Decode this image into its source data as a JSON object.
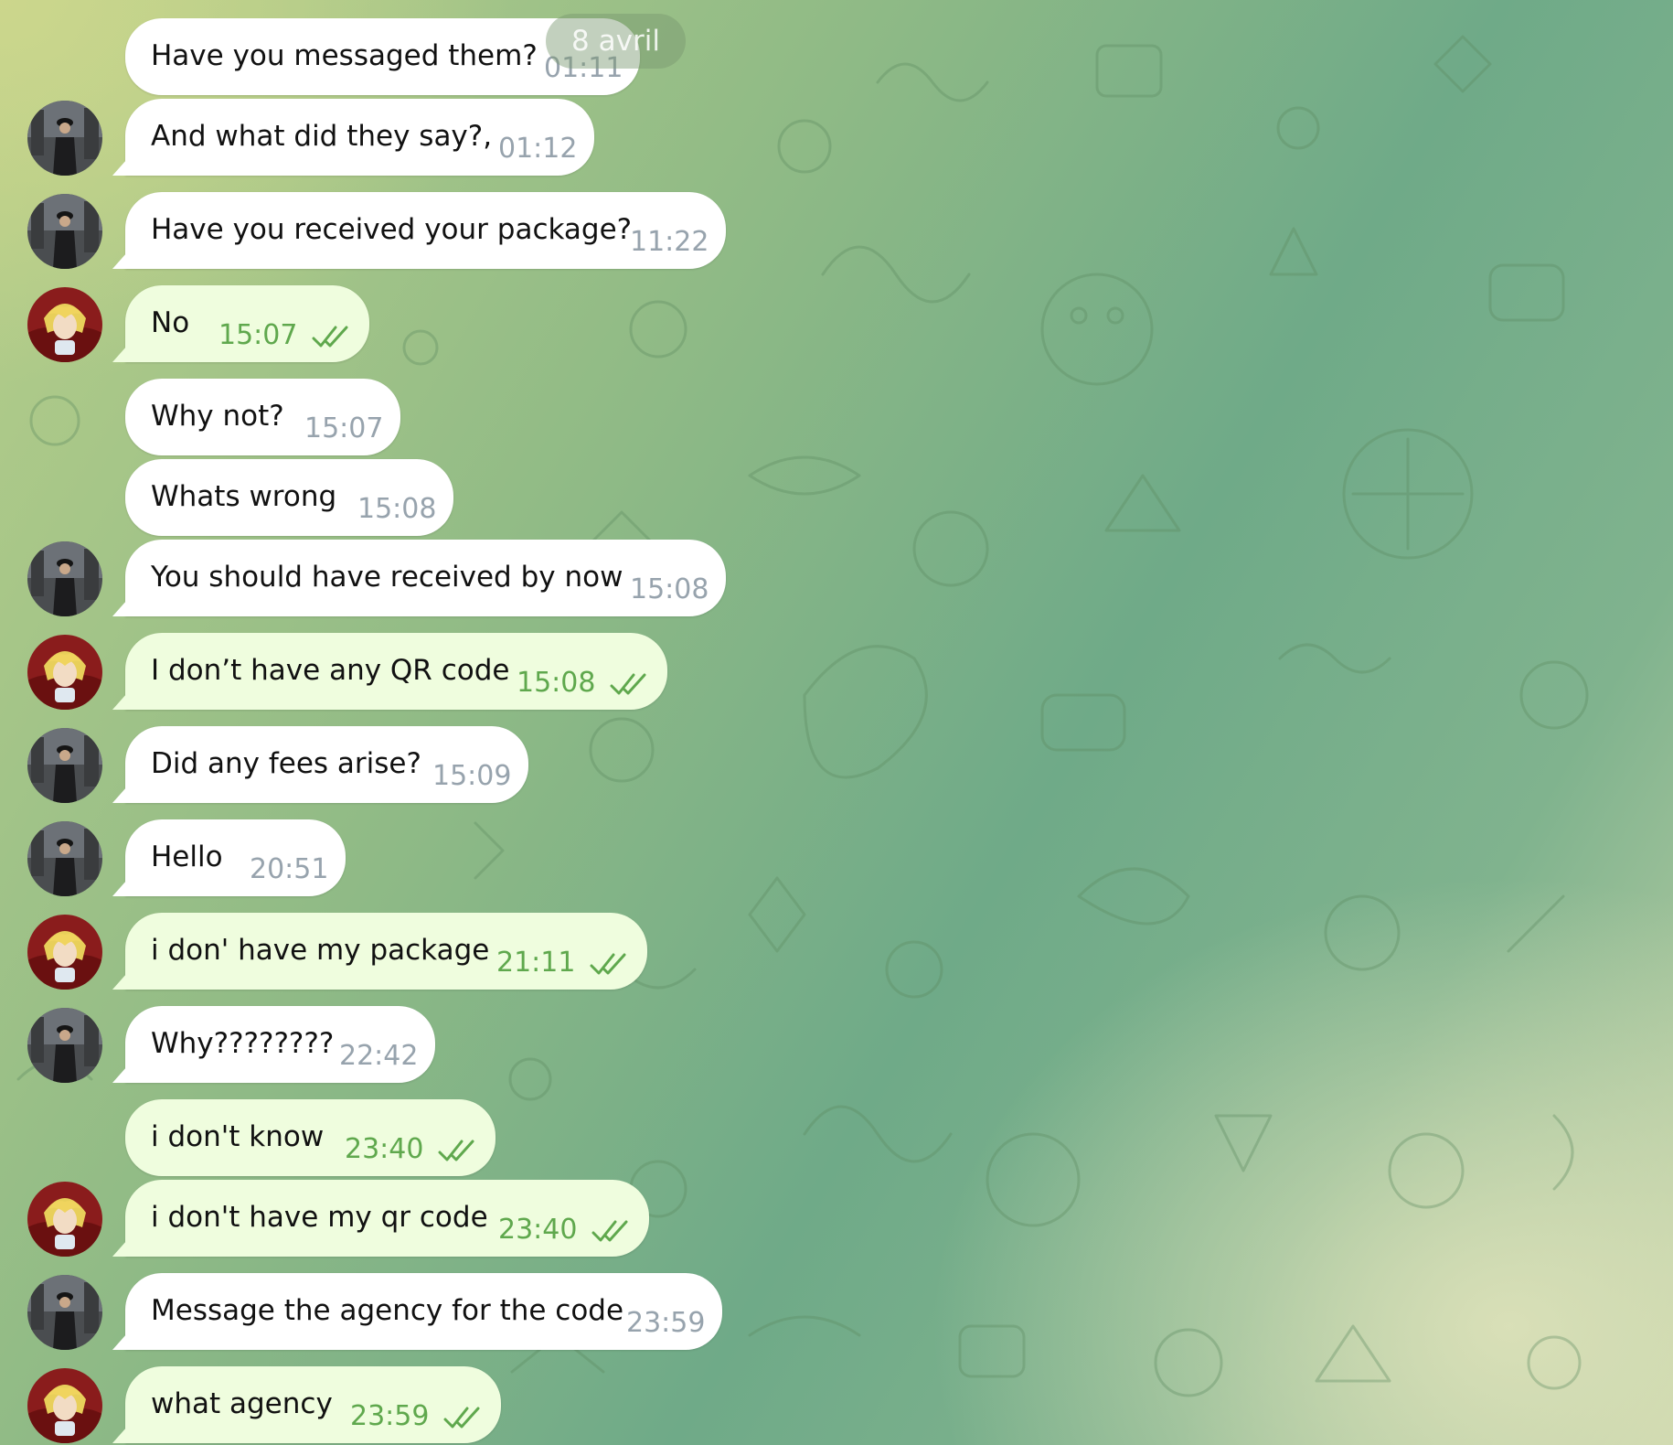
{
  "date_divider": "8 avril",
  "colors": {
    "incoming_bubble": "#ffffff",
    "outgoing_bubble": "#effdde",
    "read_check": "#5fa84d",
    "timestamp_in": "#97a3ad"
  },
  "messages": [
    {
      "text": "Have you messaged them?",
      "time": "01:11",
      "direction": "in",
      "read": false
    },
    {
      "text": "And what did they say?,",
      "time": "01:12",
      "direction": "in",
      "read": false
    },
    {
      "text": "Have you received your package?",
      "time": "11:22",
      "direction": "in",
      "read": false
    },
    {
      "text": "No",
      "time": "15:07",
      "direction": "out",
      "read": true
    },
    {
      "text": "Why not?",
      "time": "15:07",
      "direction": "in",
      "read": false
    },
    {
      "text": "Whats wrong",
      "time": "15:08",
      "direction": "in",
      "read": false
    },
    {
      "text": "You should have received by now",
      "time": "15:08",
      "direction": "in",
      "read": false
    },
    {
      "text": "I don’t have any QR code",
      "time": "15:08",
      "direction": "out",
      "read": true
    },
    {
      "text": "Did any fees arise?",
      "time": "15:09",
      "direction": "in",
      "read": false
    },
    {
      "text": "Hello",
      "time": "20:51",
      "direction": "in",
      "read": false
    },
    {
      "text": "i don' have my package",
      "time": "21:11",
      "direction": "out",
      "read": true
    },
    {
      "text": "Why????????",
      "time": "22:42",
      "direction": "in",
      "read": false
    },
    {
      "text": "i don't know",
      "time": "23:40",
      "direction": "out",
      "read": true
    },
    {
      "text": "i don't have my qr code",
      "time": "23:40",
      "direction": "out",
      "read": true
    },
    {
      "text": "Message the agency for the code",
      "time": "23:59",
      "direction": "in",
      "read": false
    },
    {
      "text": "what agency",
      "time": "23:59",
      "direction": "out",
      "read": true
    }
  ]
}
